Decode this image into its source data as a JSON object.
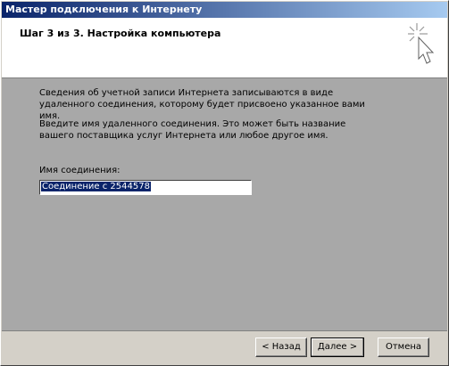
{
  "window": {
    "title": "Мастер подключения к Интернету"
  },
  "header": {
    "step_title": "Шаг 3 из 3. Настройка компьютера"
  },
  "content": {
    "para1": "Сведения об учетной записи Интернета записываются в виде удаленного соединения, которому будет присвоено указанное вами имя.",
    "para2": "Введите имя удаленного соединения. Это может быть название вашего поставщика услуг Интернета или любое другое имя.",
    "field_label": "Имя соединения:",
    "field_value": "Соединение с 2544578"
  },
  "buttons": {
    "back": "< Назад",
    "next": "Далее >",
    "cancel": "Отмена"
  },
  "colors": {
    "title_bar": "#0a246a",
    "selection": "#0a246a",
    "content_bg": "#a8a8a8",
    "face": "#d4d0c8"
  },
  "icons": {
    "header": "wizard-cursor-sparkle-icon"
  }
}
